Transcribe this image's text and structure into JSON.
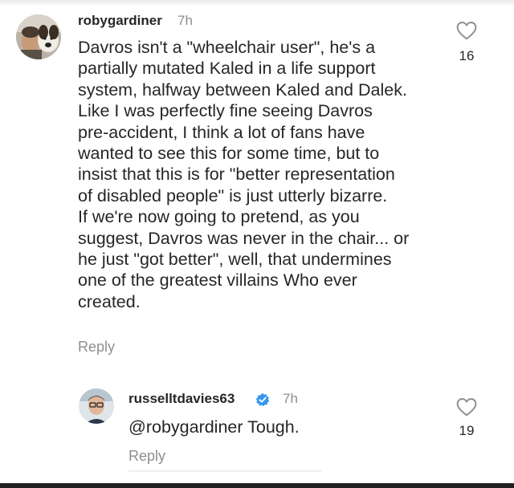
{
  "comment1": {
    "username": "robygardiner",
    "time": "7h",
    "text": "Davros isn't a \"wheelchair user\", he's a\npartially mutated Kaled in a life support\nsystem, halfway between Kaled and Dalek.\nLike I was perfectly fine seeing Davros\npre-accident, I think a lot of fans have\nwanted to see this for some time, but to\ninsist that this is for \"better representation\nof disabled people\" is just utterly bizarre.\nIf we're now going to pretend, as you\nsuggest, Davros was never in the chair... or\nhe just \"got better\", well, that undermines\none of the greatest villains Who ever\ncreated.",
    "reply_label": "Reply",
    "likes": "16"
  },
  "comment2": {
    "username": "russelltdavies63",
    "time": "7h",
    "text": "@robygardiner Tough.",
    "reply_label": "Reply",
    "likes": "19"
  },
  "colors": {
    "text": "#262626",
    "muted": "#8e8e8e",
    "verified": "#3897f0"
  }
}
